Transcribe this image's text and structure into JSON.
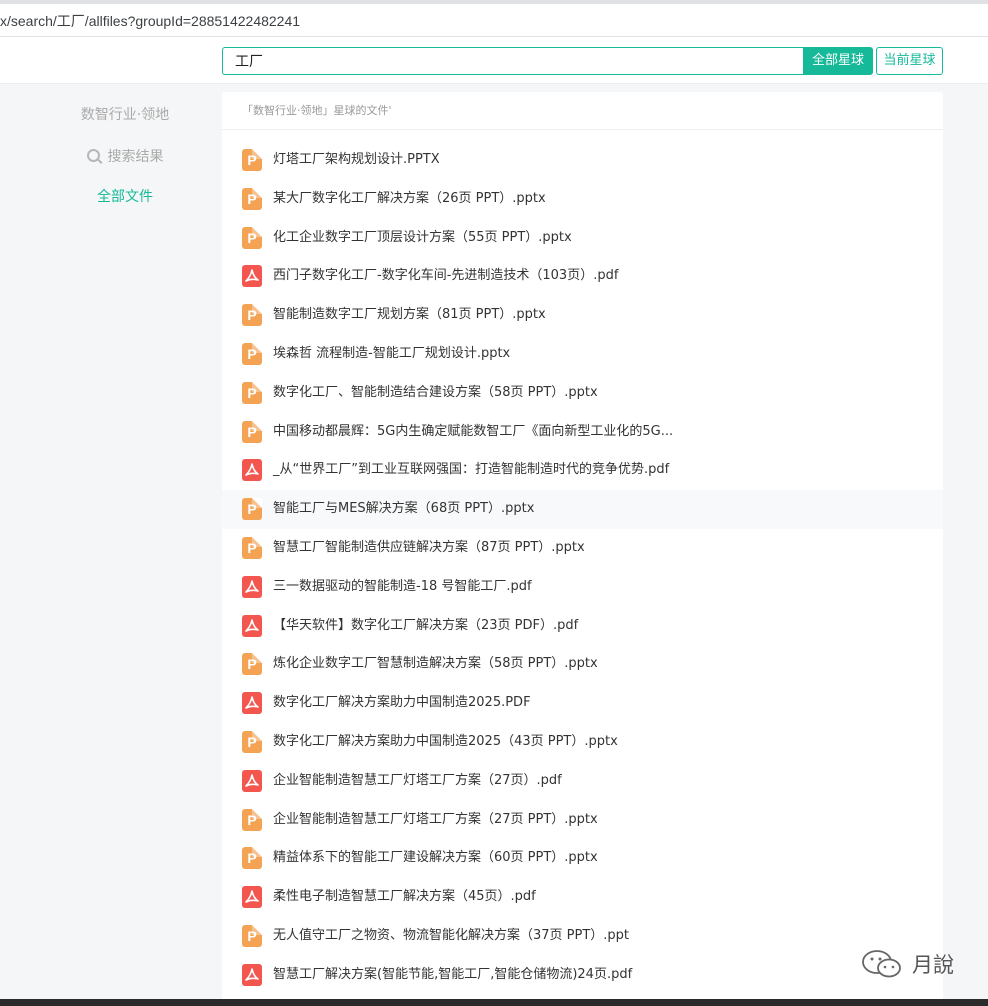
{
  "browser": {
    "url": "x/search/工厂/allfiles?groupId=28851422482241"
  },
  "header": {
    "search_value": "工厂",
    "btn_all": "全部星球",
    "btn_current": "当前星球"
  },
  "sidebar": {
    "group_name": "数智行业·领地",
    "search_results": "搜索结果",
    "all_files": "全部文件"
  },
  "panel": {
    "title": "「数智行业·领地」星球的文件'",
    "files": [
      {
        "name": "灯塔工厂架构规划设计.PPTX",
        "type": "ppt"
      },
      {
        "name": "某大厂数字化工厂解决方案（26页 PPT）.pptx",
        "type": "ppt"
      },
      {
        "name": "化工企业数字工厂顶层设计方案（55页 PPT）.pptx",
        "type": "ppt"
      },
      {
        "name": "西门子数字化工厂-数字化车间-先进制造技术（103页）.pdf",
        "type": "pdf"
      },
      {
        "name": "智能制造数字工厂规划方案（81页 PPT）.pptx",
        "type": "ppt"
      },
      {
        "name": "埃森哲 流程制造-智能工厂规划设计.pptx",
        "type": "ppt"
      },
      {
        "name": "数字化工厂、智能制造结合建设方案（58页 PPT）.pptx",
        "type": "ppt"
      },
      {
        "name": "中国移动都晨辉：5G内生确定赋能数智工厂《面向新型工业化的5G...",
        "type": "ppt"
      },
      {
        "name": "_从“世界工厂”到工业互联网强国：打造智能制造时代的竞争优势.pdf",
        "type": "pdf"
      },
      {
        "name": "智能工厂与MES解决方案（68页 PPT）.pptx",
        "type": "ppt"
      },
      {
        "name": "智慧工厂智能制造供应链解决方案（87页 PPT）.pptx",
        "type": "ppt"
      },
      {
        "name": "三一数据驱动的智能制造-18 号智能工厂.pdf",
        "type": "pdf"
      },
      {
        "name": "【华天软件】数字化工厂解决方案（23页 PDF）.pdf",
        "type": "pdf"
      },
      {
        "name": "炼化企业数字工厂智慧制造解决方案（58页 PPT）.pptx",
        "type": "ppt"
      },
      {
        "name": "数字化工厂解决方案助力中国制造2025.PDF",
        "type": "pdf"
      },
      {
        "name": "数字化工厂解决方案助力中国制造2025（43页 PPT）.pptx",
        "type": "ppt"
      },
      {
        "name": "企业智能制造智慧工厂灯塔工厂方案（27页）.pdf",
        "type": "pdf"
      },
      {
        "name": "企业智能制造智慧工厂灯塔工厂方案（27页 PPT）.pptx",
        "type": "ppt"
      },
      {
        "name": "精益体系下的智能工厂建设解决方案（60页 PPT）.pptx",
        "type": "ppt"
      },
      {
        "name": "柔性电子制造智慧工厂解决方案（45页）.pdf",
        "type": "pdf"
      },
      {
        "name": "无人值守工厂之物资、物流智能化解决方案（37页 PPT）.ppt",
        "type": "ppt"
      },
      {
        "name": "智慧工厂解决方案(智能节能,智能工厂,智能仓储物流)24页.pdf",
        "type": "pdf"
      }
    ],
    "hover_index": 9
  },
  "watermark": {
    "text": "月說",
    "icon": "wechat-icon"
  },
  "colors": {
    "accent": "#16b998",
    "ppt": "#f4a253",
    "pdf": "#f2564f"
  }
}
